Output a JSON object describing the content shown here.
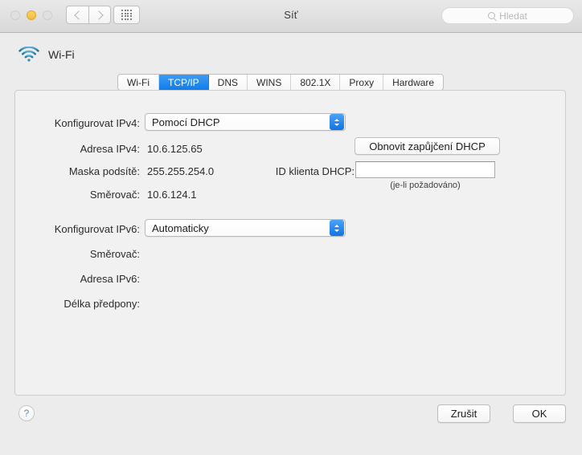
{
  "window": {
    "title": "Síť",
    "traffic_lights": [
      "close-button",
      "minimize-button",
      "zoom-button"
    ],
    "search": {
      "placeholder": "Hledat",
      "icon": "search-icon"
    },
    "nav": {
      "back_icon": "chevron-left-icon",
      "forward_icon": "chevron-right-icon",
      "show_all_icon": "grid-icon"
    }
  },
  "service": {
    "name": "Wi-Fi",
    "icon": "wifi-icon",
    "accent_color": "#1073e6"
  },
  "tabs": [
    {
      "label": "Wi-Fi",
      "selected": false
    },
    {
      "label": "TCP/IP",
      "selected": true
    },
    {
      "label": "DNS",
      "selected": false
    },
    {
      "label": "WINS",
      "selected": false
    },
    {
      "label": "802.1X",
      "selected": false
    },
    {
      "label": "Proxy",
      "selected": false
    },
    {
      "label": "Hardware",
      "selected": false
    }
  ],
  "ipv4": {
    "configure_label": "Konfigurovat IPv4:",
    "configure_value": "Pomocí DHCP",
    "address_label": "Adresa IPv4:",
    "address_value": "10.6.125.65",
    "subnet_label": "Maska podsítě:",
    "subnet_value": "255.255.254.0",
    "router_label": "Směrovač:",
    "router_value": "10.6.124.1"
  },
  "dhcp": {
    "renew_button": "Obnovit zapůjčení DHCP",
    "client_id_label": "ID klienta DHCP:",
    "client_id_value": "",
    "hint": "(je-li požadováno)"
  },
  "ipv6": {
    "configure_label": "Konfigurovat IPv6:",
    "configure_value": "Automaticky",
    "router_label": "Směrovač:",
    "router_value": "",
    "address_label": "Adresa IPv6:",
    "address_value": "",
    "prefix_label": "Délka předpony:",
    "prefix_value": ""
  },
  "footer": {
    "help_label": "?",
    "cancel_label": "Zrušit",
    "ok_label": "OK"
  }
}
